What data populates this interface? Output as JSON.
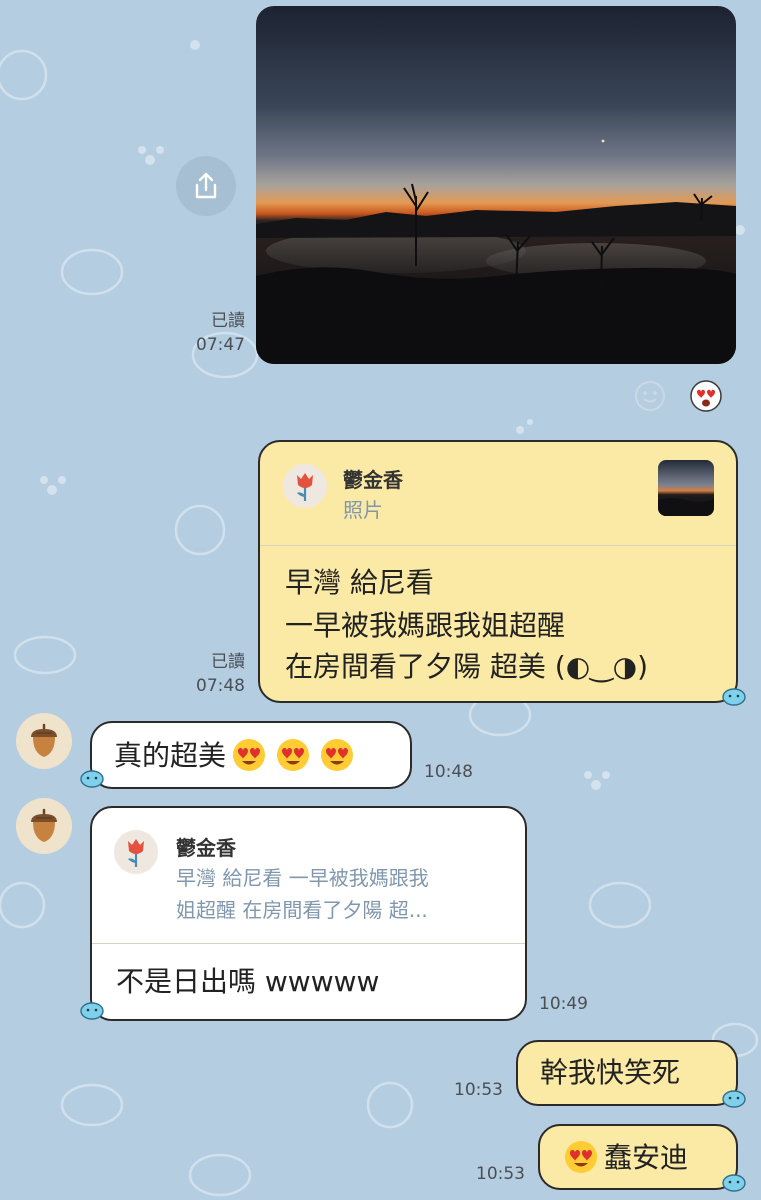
{
  "messages": {
    "photo": {
      "read_label": "已讀",
      "time": "07:47"
    },
    "reply1": {
      "quote_name": "鬱金香",
      "quote_type": "照片",
      "lines": [
        "早灣 給尼看",
        "一早被我媽跟我姐超醒",
        "在房間看了夕陽 超美 (◐‿◑)"
      ],
      "read_label": "已讀",
      "time": "07:48"
    },
    "in1": {
      "text": "真的超美",
      "time": "10:48"
    },
    "in2": {
      "quote_name": "鬱金香",
      "quote_lines": [
        "早灣 給尼看 一早被我媽跟我",
        "姐超醒 在房間看了夕陽 超..."
      ],
      "text": "不是日出嗎 wwwww",
      "time": "10:49"
    },
    "out1": {
      "text": "幹我快笑死",
      "time": "10:53"
    },
    "out2": {
      "text": "蠢安迪",
      "time": "10:53"
    }
  },
  "icons": {
    "share": "share-icon",
    "react": "smile-react-icon",
    "reaction": "heart-eyes-emoji",
    "avatar_self": "tulip-icon",
    "avatar_friend": "acorn-icon"
  },
  "colors": {
    "background": "#b5cde0",
    "bubble_out": "#fbeaa5",
    "bubble_in": "#ffffff",
    "quote_sub": "#8097ad"
  }
}
